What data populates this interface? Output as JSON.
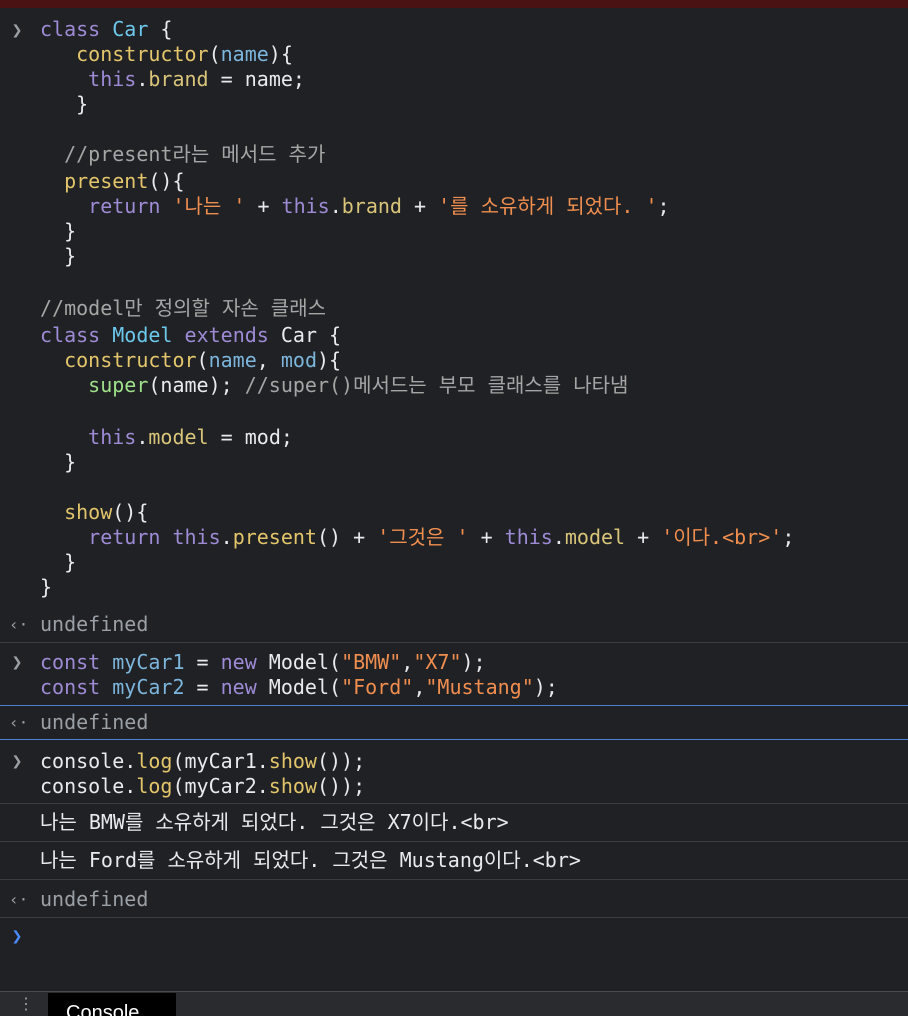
{
  "entry1": {
    "lines": [
      "class Car {",
      "   constructor(name){",
      "    this.brand = name;",
      "   }",
      "",
      "  //present라는 메서드 추가",
      "  present(){",
      "    return '나는 ' + this.brand + '를 소유하게 되었다. ';",
      "  }",
      "  }",
      "",
      "//model만 정의할 자손 클래스",
      "class Model extends Car {",
      "  constructor(name, mod){",
      "    super(name); //super()메서드는 부모 클래스를 나타냄",
      "",
      "    this.model = mod;",
      "  }",
      "",
      "  show(){",
      "    return this.present() + '그것은 ' + this.model + '이다.<br>';",
      "  }",
      "}"
    ],
    "result": "undefined"
  },
  "entry2": {
    "lines": [
      "const myCar1 = new Model(\"BMW\",\"X7\");",
      "const myCar2 = new Model(\"Ford\",\"Mustang\");"
    ],
    "result": "undefined"
  },
  "entry3": {
    "lines": [
      "console.log(myCar1.show());",
      "console.log(myCar2.show());"
    ],
    "logs": [
      "나는 BMW를 소유하게 되었다. 그것은 X7이다.<br>",
      "나는 Ford를 소유하게 되었다. 그것은 Mustang이다.<br>"
    ],
    "result": "undefined"
  },
  "icons": {
    "prompt": "chevron-right-icon",
    "return": "return-arrow-icon",
    "menu": "kebab-menu-icon"
  },
  "drawer": {
    "tab_label": "Console"
  },
  "colors": {
    "background": "#202124",
    "keyword": "#9e8bd6",
    "class_name": "#6cc8ec",
    "function": "#e3c66b",
    "string": "#f08e4f",
    "comment": "#a5a5a5",
    "prompt_active": "#4a8bff"
  }
}
